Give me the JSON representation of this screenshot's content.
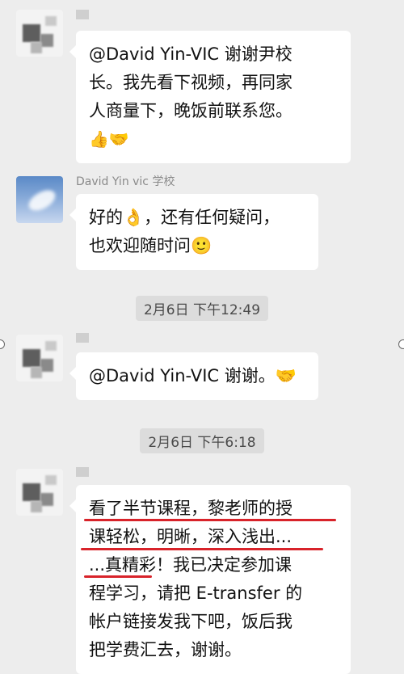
{
  "messages": [
    {
      "sender": "",
      "text_lines": [
        "@David Yin-VIC 谢谢尹校",
        "长。我先看下视频，再同家",
        "人商量下，晚饭前联系您。"
      ],
      "emojis": "👍🤝"
    },
    {
      "sender": "David Yin vic 学校",
      "text_lines": [
        "好的👌，还有任何疑问，",
        "也欢迎随时问🙂"
      ]
    },
    {
      "sender": "",
      "text_lines": [
        "@David Yin-VIC 谢谢。🤝"
      ]
    },
    {
      "sender": "",
      "text_lines": [
        "看了半节课程，黎老师的授",
        "课轻松，明晰，深入浅出...",
        "...真精彩！我已决定参加课",
        "程学习，请把 E-transfer 的",
        "帐户链接发我下吧，饭后我",
        "把学费汇去，谢谢。"
      ]
    }
  ],
  "timestamps": [
    "2月6日 下午12:49",
    "2月6日 下午6:18"
  ],
  "icons": {
    "thumbs_up": "thumbs-up-emoji",
    "handshake": "handshake-emoji",
    "ok_hand": "ok-hand-emoji",
    "smile": "smile-emoji"
  },
  "colors": {
    "background": "#ededed",
    "bubble": "#ffffff",
    "highlight_underline": "#d8232a"
  }
}
